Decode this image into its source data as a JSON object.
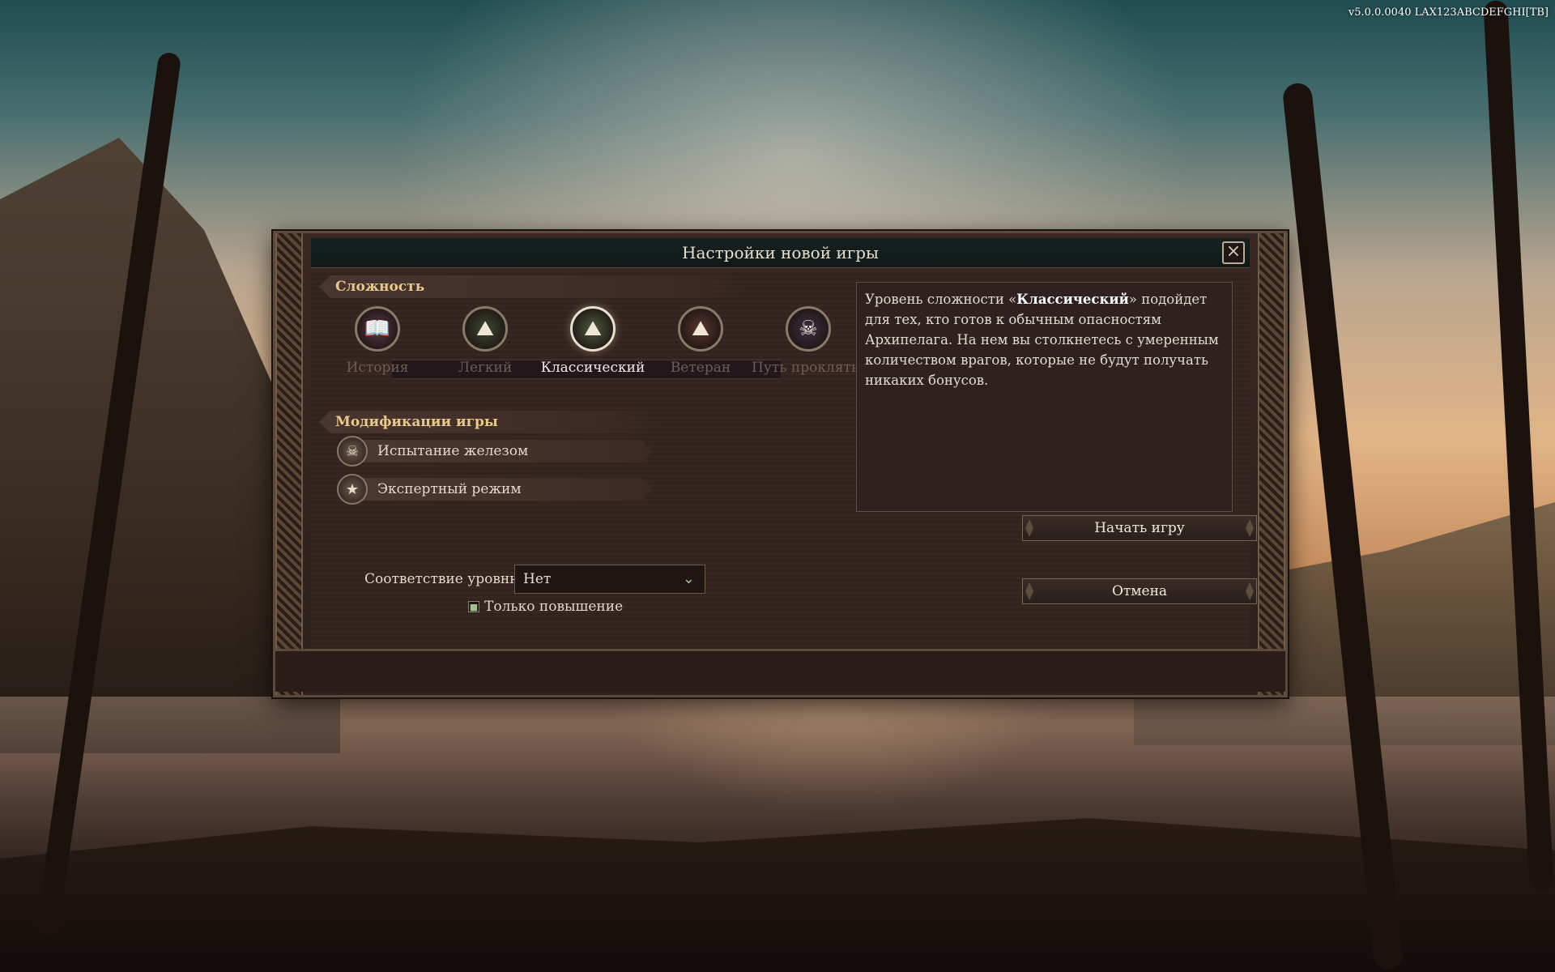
{
  "version": "v5.0.0.0040  LAX123ABCDEFGHI[TB]",
  "dialog": {
    "title": "Настройки новой игры",
    "close_icon": "×"
  },
  "difficulty": {
    "header": "Сложность",
    "options": [
      {
        "label": "История",
        "icon": "book-icon",
        "glyph": "📖",
        "color": "#5a3a4a"
      },
      {
        "label": "Легкий",
        "icon": "mountain-easy-icon",
        "glyph": "⛰",
        "color": "#3d4a30"
      },
      {
        "label": "Классический",
        "icon": "mountain-classic-icon",
        "glyph": "⛰",
        "color": "#4f5b3f"
      },
      {
        "label": "Ветеран",
        "icon": "mountain-veteran-icon",
        "glyph": "⛰",
        "color": "#5a3630"
      },
      {
        "label": "Путь проклятых",
        "icon": "path-of-damned-icon",
        "glyph": "☠",
        "color": "#3e2f44"
      }
    ],
    "selected_index": 2,
    "description": {
      "prefix": "Уровень сложности «",
      "bold": "Классический",
      "suffix": "» подойдет для тех, кто готов к обычным опасностям Архипелага. На нем вы столкнетесь с умеренным количеством врагов, которые не будут получать никаких бонусов."
    }
  },
  "modifications": {
    "header": "Модификации игры",
    "items": [
      {
        "label": "Испытание железом",
        "icon": "skull-icon",
        "glyph": "☠"
      },
      {
        "label": "Экспертный режим",
        "icon": "head-star-icon",
        "glyph": "★"
      }
    ]
  },
  "level_scaling": {
    "label": "Соответствие уровню",
    "value": "Нет",
    "checkbox_label": "Только повышение",
    "checkbox_checked": true
  },
  "buttons": {
    "start": "Начать игру",
    "cancel": "Отмена"
  }
}
